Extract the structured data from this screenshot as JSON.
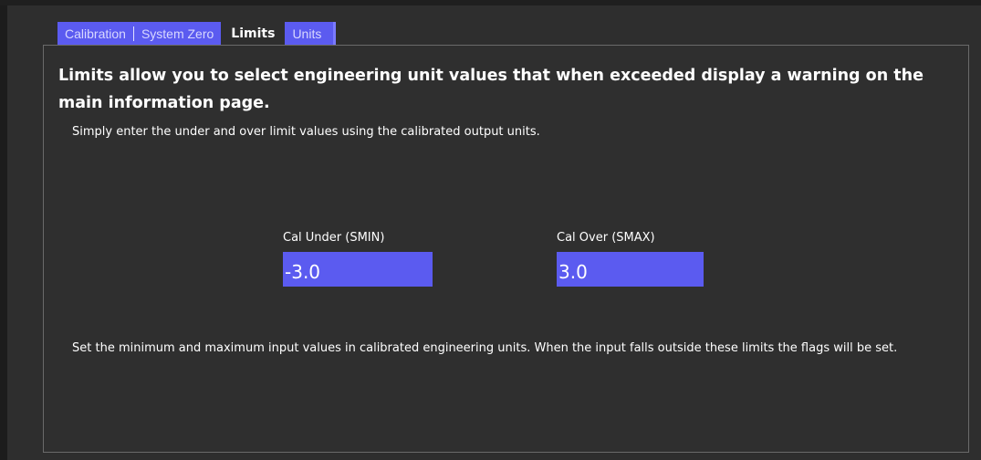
{
  "tabs": {
    "calibration": "Calibration",
    "system_zero": "System Zero",
    "limits": "Limits",
    "units": "Units"
  },
  "heading": "Limits allow you to select engineering unit values that when exceeded display a warning on the main information page.",
  "subtext": "Simply enter the under and over limit values using the calibrated output units.",
  "cal_under": {
    "label": "Cal Under (SMIN)",
    "value": "-3.0"
  },
  "cal_over": {
    "label": "Cal Over (SMAX)",
    "value": "3.0"
  },
  "footnote": "Set the minimum and maximum input values in calibrated engineering units. When the input falls outside these limits the flags will be set.",
  "colors": {
    "accent": "#5b5bf0",
    "background": "#2e2e2e",
    "panel_border": "#6a6a6a",
    "text": "#ffffff"
  }
}
